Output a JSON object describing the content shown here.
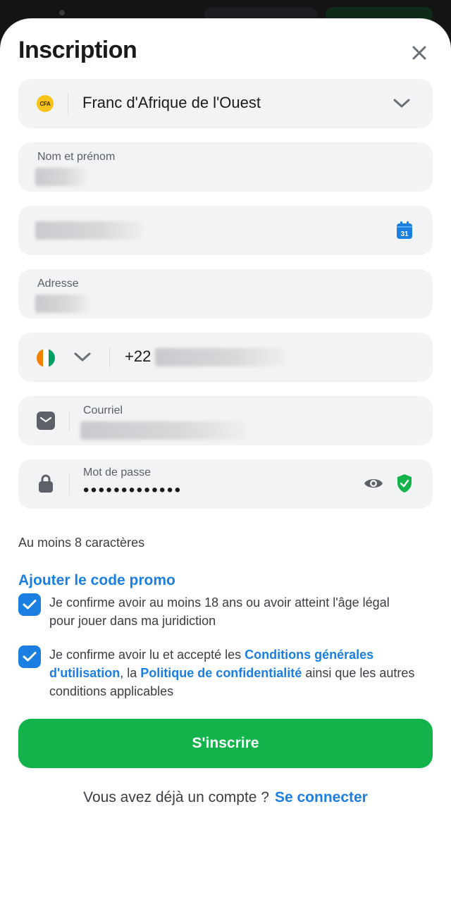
{
  "header": {
    "title": "Inscription"
  },
  "currency": {
    "icon_text": "CFA",
    "value": "Franc d'Afrique de l'Ouest"
  },
  "fields": {
    "fullname_label": "Nom et prénom",
    "address_label": "Adresse",
    "phone_prefix": "+22",
    "email_label": "Courriel",
    "password_label": "Mot de passe",
    "password_value": "•••••••••••••",
    "calendar_day": "31"
  },
  "hint": "Au moins 8 caractères",
  "promo_link": "Ajouter le code promo",
  "consents": {
    "age_text": "Je confirme avoir au moins 18 ans ou avoir atteint l'âge légal pour jouer dans ma juridiction",
    "terms_prefix": "Je confirme avoir lu et accepté les ",
    "terms_link": "Conditions générales d'utilisation",
    "terms_middle": ", la ",
    "privacy_link": "Politique de confidentialité",
    "terms_suffix": " ainsi que les autres conditions applicables"
  },
  "submit_label": "S'inscrire",
  "login": {
    "prompt": "Vous avez déjà un compte ?",
    "link": "Se connecter"
  },
  "colors": {
    "accent_blue": "#1a7fe0",
    "primary_green": "#12b34a",
    "field_bg": "#f2f3f5",
    "shield_green": "#12b34a"
  },
  "icons": [
    "close-icon",
    "chevron-down-icon",
    "calendar-icon",
    "email-icon",
    "lock-icon",
    "eye-icon",
    "shield-check-icon",
    "checkmark-icon",
    "ivory-coast-flag-icon"
  ]
}
